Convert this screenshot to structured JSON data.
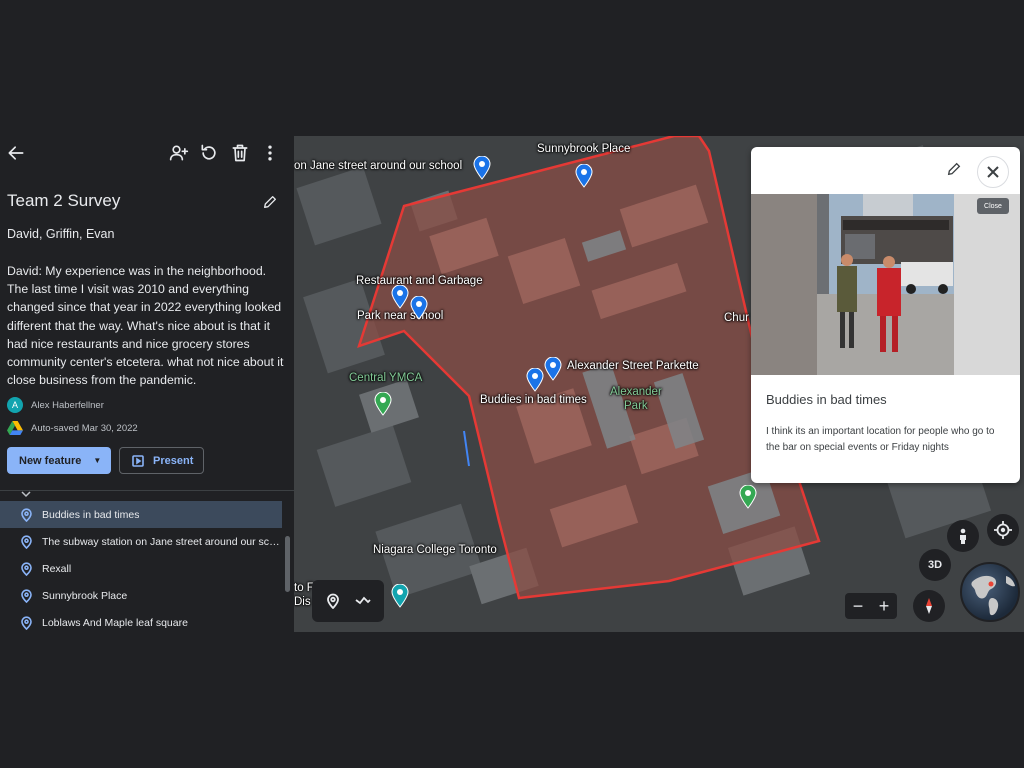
{
  "panel": {
    "project_title": "Team 2 Survey",
    "members": "David, Griffin, Evan",
    "description": "David: My experience was in the neighborhood. The last time I visit was 2010 and everything changed since that year in 2022 everything looked different that the way. What's nice about is that it had nice restaurants and nice grocery stores community center's etcetera. what not nice about it close business from the pandemic.",
    "author_initial": "A",
    "author": "Alex Haberfellner",
    "autosave": "Auto-saved Mar 30, 2022",
    "new_feature_label": "New feature",
    "present_label": "Present",
    "features": [
      {
        "label": "Buddies in bad times",
        "selected": true
      },
      {
        "label": "The subway station on Jane street around our sch...",
        "selected": false
      },
      {
        "label": "Rexall",
        "selected": false
      },
      {
        "label": "Sunnybrook Place",
        "selected": false
      },
      {
        "label": "Loblaws And Maple leaf square",
        "selected": false
      }
    ]
  },
  "map": {
    "labels": {
      "subway": "on Jane street around our school",
      "sunnybrook": "Sunnybrook Place",
      "restaurant": "Restaurant and Garbage",
      "park_school": "Park near school",
      "ymca": "Central YMCA",
      "alexander_parkette": "Alexander Street Parkette",
      "alexander_park_1": "Alexander",
      "alexander_park_2": "Park",
      "buddies": "Buddies in bad times",
      "niagara": "Niagara College Toronto",
      "chur": "Chur",
      "edge_1": "to F",
      "edge_2": "Dis"
    },
    "btn_3d": "3D",
    "zoom_out": "−",
    "zoom_in": "+",
    "colors": {
      "polygon": "#e53935",
      "pin_blue": "#1a73e8",
      "pin_green": "#34a853"
    }
  },
  "card": {
    "tooltip": "Close",
    "title": "Buddies in bad times",
    "description": "I think its an important location for people who go to the bar on special events or Friday nights"
  }
}
